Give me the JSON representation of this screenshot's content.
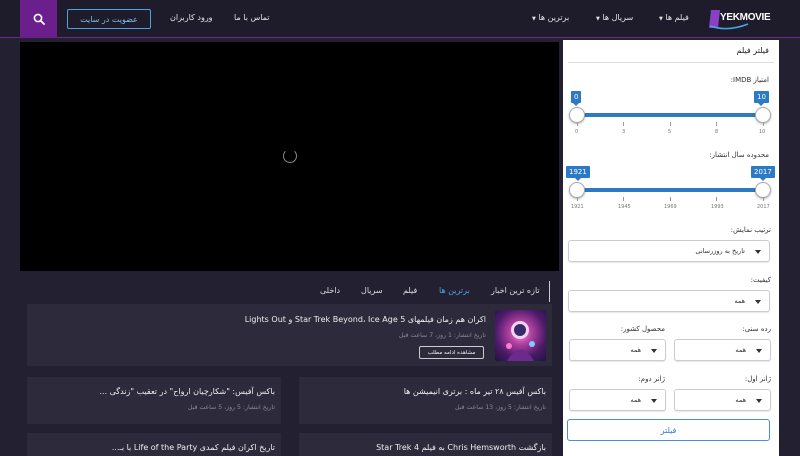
{
  "header": {
    "logo_text": "YEKMOVIE",
    "join_label": "عضویت در سایت",
    "login_label": "ورود کاربران",
    "contact_label": "تماس با ما",
    "nav": [
      {
        "label": "فیلم ها"
      },
      {
        "label": "سریال ها"
      },
      {
        "label": "برترین ها"
      }
    ]
  },
  "tabs": [
    {
      "label": "تازه ترین اخبار",
      "active": false
    },
    {
      "label": "برترین ها",
      "active": true
    },
    {
      "label": "فیلم",
      "active": false
    },
    {
      "label": "سریال",
      "active": false
    },
    {
      "label": "داخلی",
      "active": false
    }
  ],
  "news": {
    "featured": {
      "title": "اکران هم زمان فیلمهای Star Trek Beyond، Ice Age 5 و Lights Out",
      "date": "تاریخ انتشار: 1 روز، 7 ساعت قبل",
      "read_more": "مشاهده ادامه مطلب"
    },
    "items": [
      {
        "title": "باکس آفیس ۲۸ تیر ماه : برتری انیمیشن ها",
        "date": "تاریخ انتشار: 5 روز، 13 ساعت قبل"
      },
      {
        "title": "باکس آفیس: \"شکارچیان ارواح\" در تعقیب \"زندگی ...",
        "date": "تاریخ انتشار: 5 روز، 5 ساعت قبل"
      },
      {
        "title": "بازگشت Chris Hemsworth به فیلم Star Trek 4",
        "date": ""
      },
      {
        "title": "تاریخ اکران فیلم کمدی Life of the Party با بـ...",
        "date": ""
      }
    ]
  },
  "sidebar": {
    "title": "فیلتر فیلم",
    "imdb_label": "امتیاز IMDB:",
    "imdb_min": "0",
    "imdb_max": "10",
    "imdb_ticks": [
      "0",
      "3",
      "5",
      "8",
      "10"
    ],
    "year_label": "محدوده سال انتشار:",
    "year_min": "1921",
    "year_max": "2017",
    "year_ticks": [
      "1921",
      "1945",
      "1969",
      "1993",
      "2017"
    ],
    "sort_label": "ترتیب نمایش:",
    "sort_value": "تاریخ به روزرسانی",
    "quality_label": "کیفیت:",
    "quality_value": "همه",
    "age_label": "رده سنی:",
    "age_value": "همه",
    "country_label": "محصول کشور:",
    "country_value": "همه",
    "genre1_label": "ژانر اول:",
    "genre1_value": "همه",
    "genre2_label": "ژانر دوم:",
    "genre2_value": "همه",
    "filter_button": "فیلتر"
  },
  "colors": {
    "accent": "#6b1f8c",
    "link": "#4aa3e6",
    "slider": "#2c79c5"
  }
}
